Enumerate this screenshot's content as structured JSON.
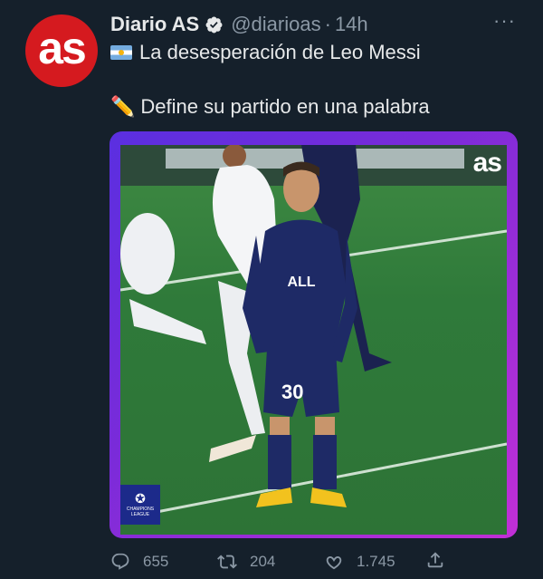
{
  "account": {
    "avatar_text": "as",
    "name": "Diario AS",
    "handle": "@diarioas",
    "separator": "·",
    "time": "14h",
    "more": "···"
  },
  "tweet": {
    "line1": "La desesperación de Leo Messi",
    "line2": "Define su partido en una palabra",
    "flag_icon": "argentina-flag-icon",
    "pencil_icon": "✏️"
  },
  "media": {
    "watermark": "as",
    "badge_text": "CHAMPIONS LEAGUE",
    "player_number": "30",
    "sponsor": "ALL",
    "colors": {
      "frame_start": "#5a2fe0",
      "frame_end": "#c12fd6",
      "pitch": "#2f7a3a",
      "kit": "#1e2a66"
    }
  },
  "actions": {
    "replies": "655",
    "retweets": "204",
    "likes": "1.745"
  }
}
